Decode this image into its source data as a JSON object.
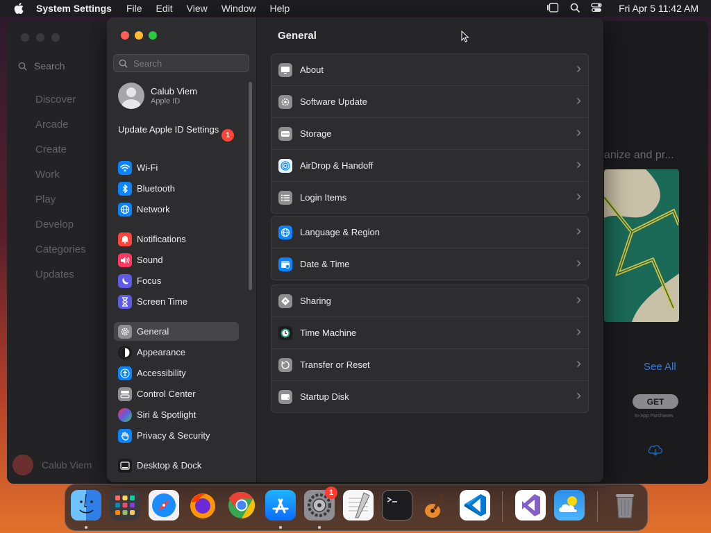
{
  "menubar": {
    "app_name": "System Settings",
    "menus": [
      "File",
      "Edit",
      "View",
      "Window",
      "Help"
    ],
    "clock": "Fri Apr 5  11:42 AM"
  },
  "background_app": {
    "search_label": "Search",
    "nav": [
      "Discover",
      "Arcade",
      "Create",
      "Work",
      "Play",
      "Develop",
      "Categories",
      "Updates"
    ],
    "user_name": "Calub Viem",
    "heading_fragment": "anize and pr...",
    "see_all": "See All",
    "get_label": "GET",
    "in_app": "In-App Purchases"
  },
  "sidebar": {
    "search_placeholder": "Search",
    "profile": {
      "name": "Calub Viem",
      "subtitle": "Apple ID"
    },
    "update_text": "Update Apple ID Settings",
    "update_badge": "1",
    "items": [
      {
        "label": "Wi-Fi",
        "icon": "wifi-icon",
        "color": "#0a84ff"
      },
      {
        "label": "Bluetooth",
        "icon": "bluetooth-icon",
        "color": "#0a84ff"
      },
      {
        "label": "Network",
        "icon": "globe-icon",
        "color": "#0a84ff"
      },
      {
        "label": "Notifications",
        "icon": "bell-icon",
        "color": "#ff453a"
      },
      {
        "label": "Sound",
        "icon": "speaker-icon",
        "color": "#ff375f"
      },
      {
        "label": "Focus",
        "icon": "moon-icon",
        "color": "#5e5ce6"
      },
      {
        "label": "Screen Time",
        "icon": "hourglass-icon",
        "color": "#5e5ce6"
      },
      {
        "label": "General",
        "icon": "gear-icon",
        "color": "#8e8e93"
      },
      {
        "label": "Appearance",
        "icon": "appearance-icon",
        "color": "#1c1c1e"
      },
      {
        "label": "Accessibility",
        "icon": "accessibility-icon",
        "color": "#0a84ff"
      },
      {
        "label": "Control Center",
        "icon": "control-center-icon",
        "color": "#8e8e93"
      },
      {
        "label": "Siri & Spotlight",
        "icon": "siri-icon",
        "color": "#bf5af2"
      },
      {
        "label": "Privacy & Security",
        "icon": "hand-icon",
        "color": "#0a84ff"
      },
      {
        "label": "Desktop & Dock",
        "icon": "dock-icon",
        "color": "#1c1c1e"
      }
    ],
    "selected": "General"
  },
  "main": {
    "title": "General",
    "groups": [
      [
        {
          "label": "About",
          "icon": "computer-icon",
          "color": "#8e8e93"
        },
        {
          "label": "Software Update",
          "icon": "gear-badge-icon",
          "color": "#8e8e93"
        },
        {
          "label": "Storage",
          "icon": "drive-icon",
          "color": "#8e8e93"
        },
        {
          "label": "AirDrop & Handoff",
          "icon": "airdrop-icon",
          "color": "#5ac8fa"
        },
        {
          "label": "Login Items",
          "icon": "list-icon",
          "color": "#8e8e93"
        }
      ],
      [
        {
          "label": "Language & Region",
          "icon": "globe-icon",
          "color": "#0a84ff"
        },
        {
          "label": "Date & Time",
          "icon": "calendar-clock-icon",
          "color": "#0a84ff"
        }
      ],
      [
        {
          "label": "Sharing",
          "icon": "sharing-icon",
          "color": "#8e8e93"
        },
        {
          "label": "Time Machine",
          "icon": "time-machine-icon",
          "color": "#2c9b76"
        },
        {
          "label": "Transfer or Reset",
          "icon": "reset-icon",
          "color": "#8e8e93"
        },
        {
          "label": "Startup Disk",
          "icon": "disk-icon",
          "color": "#8e8e93"
        }
      ]
    ]
  },
  "dock": {
    "apps": [
      "Finder",
      "Launchpad",
      "Safari",
      "Firefox",
      "Chrome",
      "App Store",
      "System Settings",
      "TextEdit",
      "Terminal",
      "GarageBand",
      "VS Code",
      "Visual Studio",
      "Weather",
      "Trash"
    ],
    "system_settings_badge": "1"
  }
}
